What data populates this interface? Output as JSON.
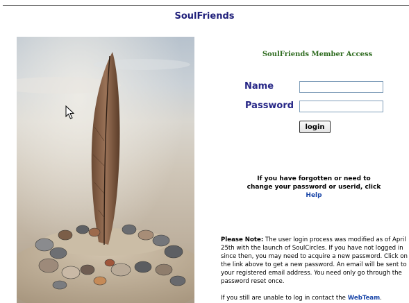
{
  "site": {
    "title": "SoulFriends"
  },
  "photo": {
    "alt": "feather standing in sand with pebbles"
  },
  "login": {
    "heading": "SoulFriends Member Access",
    "name_label": "Name",
    "password_label": "Password",
    "name_value": "",
    "password_value": "",
    "button_label": "login"
  },
  "help": {
    "text": "If you have forgotten or need to change your password or userid, click",
    "link_label": "Help"
  },
  "note": {
    "lead": "Please Note:",
    "body": "The user login process was modified as of April 25th with the launch of SoulCircles. If you have not logged in since then, you may need to acquire a new password. Click on the link above to get a new password. An email will be sent to your registered email address. You need only go through the password reset once."
  },
  "contact": {
    "text": "If you still are unable to log in contact the",
    "link_label": "WebTeam",
    "suffix": "."
  },
  "colors": {
    "title": "#1f1f7a",
    "heading": "#2e6b1f",
    "labels": "#262686",
    "links": "#1a46a8"
  }
}
